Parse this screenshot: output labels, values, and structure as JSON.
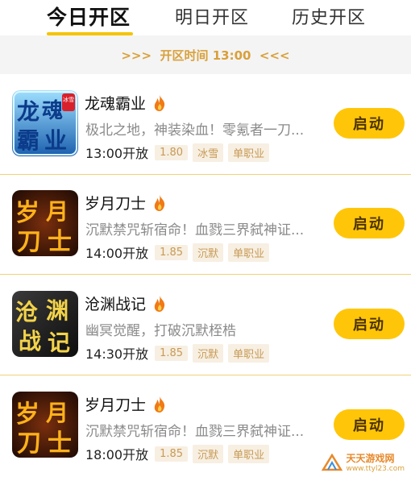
{
  "tabs": [
    {
      "label": "今日开区"
    },
    {
      "label": "明日开区"
    },
    {
      "label": "历史开区"
    }
  ],
  "banner": {
    "text": ">>>  开区时间 13:00  <<<"
  },
  "games": [
    {
      "icon": "longhun-baye-game-icon",
      "icon_chars": [
        "龙",
        "魂",
        "霸",
        "业"
      ],
      "icon_badge": "冰雪",
      "title": "龙魂霸业",
      "desc": "极北之地，神装染血！零氪者一刀...",
      "time": "13:00开放",
      "tags": [
        "1.80",
        "冰雪",
        "单职业"
      ],
      "button": "启动"
    },
    {
      "icon": "suiyue-daoshi-game-icon",
      "icon_chars": [
        "岁",
        "月",
        "刀",
        "士"
      ],
      "title": "岁月刀士",
      "desc": "沉默禁咒斩宿命！血戮三界弑神证...",
      "time": "14:00开放",
      "tags": [
        "1.85",
        "沉默",
        "单职业"
      ],
      "button": "启动"
    },
    {
      "icon": "cangyuan-zhanji-game-icon",
      "icon_chars": [
        "沧",
        "渊",
        "战",
        "记"
      ],
      "title": "沧渊战记",
      "desc": "幽冥觉醒，打破沉默桎梏",
      "time": "14:30开放",
      "tags": [
        "1.85",
        "沉默",
        "单职业"
      ],
      "button": "启动"
    },
    {
      "icon": "suiyue-daoshi-game-icon",
      "icon_chars": [
        "岁",
        "月",
        "刀",
        "士"
      ],
      "title": "岁月刀士",
      "desc": "沉默禁咒斩宿命！血戮三界弑神证...",
      "time": "18:00开放",
      "tags": [
        "1.85",
        "沉默",
        "单职业"
      ],
      "button": "启动"
    }
  ],
  "watermark": {
    "line1": "天天游戏网",
    "line2": "www.ttyl23.com"
  },
  "colors": {
    "accent": "#ffc609",
    "tab_underline": "#f5c400",
    "banner_text": "#d9a03a",
    "tag_text": "#c79a56",
    "tag_bg": "#f7efe2"
  }
}
